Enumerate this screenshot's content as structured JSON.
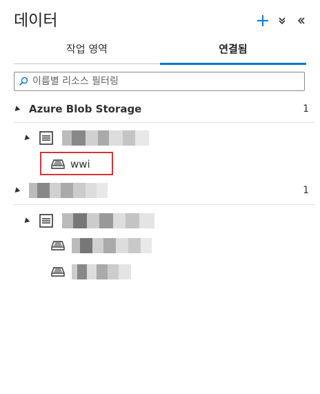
{
  "header": {
    "title": "데이터",
    "icons": [
      "add-icon",
      "collapse-down-icon",
      "collapse-left-icon"
    ]
  },
  "tabs": [
    {
      "label": "작업 영역",
      "active": false
    },
    {
      "label": "연결됨",
      "active": true
    }
  ],
  "search": {
    "placeholder": "이름별 리소스 필터링"
  },
  "tree": {
    "group1": {
      "label": "Azure Blob Storage",
      "count": "1",
      "account_item": {
        "label": ""
      },
      "container_item": {
        "label": "wwi"
      }
    },
    "group2": {
      "label": "",
      "count": "1",
      "account_item": {
        "label": ""
      },
      "containers": [
        {
          "label": ""
        },
        {
          "label": ""
        }
      ]
    }
  },
  "colors": {
    "accent": "#0078d4",
    "highlight": "#d13438"
  }
}
